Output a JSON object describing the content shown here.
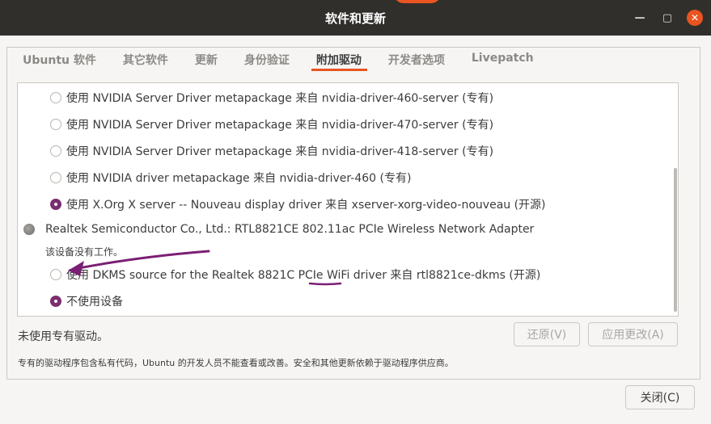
{
  "window": {
    "title": "软件和更新"
  },
  "tabs": [
    {
      "label": "Ubuntu 软件",
      "active": false
    },
    {
      "label": "其它软件",
      "active": false
    },
    {
      "label": "更新",
      "active": false
    },
    {
      "label": "身份验证",
      "active": false
    },
    {
      "label": "附加驱动",
      "active": true
    },
    {
      "label": "开发者选项",
      "active": false
    },
    {
      "label": "Livepatch",
      "active": false
    }
  ],
  "drivers": {
    "nvidia_options": [
      {
        "label": "使用 NVIDIA Server Driver metapackage 来自 nvidia-driver-460-server (专有)",
        "selected": false
      },
      {
        "label": "使用 NVIDIA Server Driver metapackage 来自 nvidia-driver-470-server (专有)",
        "selected": false
      },
      {
        "label": "使用 NVIDIA Server Driver metapackage 来自 nvidia-driver-418-server (专有)",
        "selected": false
      },
      {
        "label": "使用 NVIDIA driver metapackage 来自 nvidia-driver-460 (专有)",
        "selected": false
      },
      {
        "label": "使用 X.Org X server -- Nouveau display driver 来自 xserver-xorg-video-nouveau (开源)",
        "selected": true
      }
    ],
    "realtek_device": {
      "name": "Realtek Semiconductor Co., Ltd.: RTL8821CE 802.11ac PCIe Wireless Network Adapter",
      "note": "该设备没有工作。",
      "options": [
        {
          "label": "使用 DKMS source for the Realtek 8821C PCIe WiFi driver 来自 rtl8821ce-dkms (开源)",
          "selected": false
        },
        {
          "label": "不使用设备",
          "selected": true
        }
      ]
    }
  },
  "status": "未使用专有驱动。",
  "buttons": {
    "revert": "还原(V)",
    "apply": "应用更改(A)",
    "close": "关闭(C)"
  },
  "footnote": "专有的驱动程序包含私有代码，Ubuntu 的开发人员不能查看或改善。安全和其他更新依赖于驱动程序供应商。",
  "colors": {
    "accent": "#e95420",
    "radio_selected": "#7a2d6f",
    "annotation": "#7a1f74"
  },
  "icons": {
    "minimize": "minimize-icon",
    "maximize": "maximize-icon",
    "close": "close-icon"
  }
}
